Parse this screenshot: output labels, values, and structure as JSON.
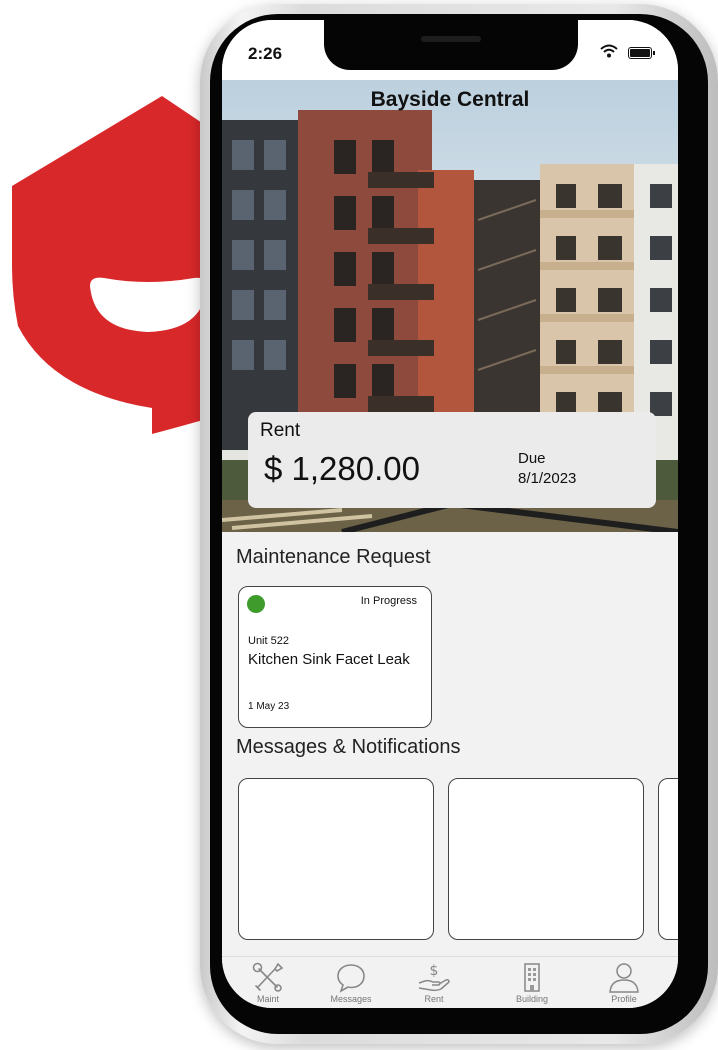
{
  "status_bar": {
    "time": "2:26"
  },
  "property": {
    "name": "Bayside Central"
  },
  "rent": {
    "label": "Rent",
    "amount": "$ 1,280.00",
    "due_label": "Due",
    "due_date": "8/1/2023"
  },
  "maintenance": {
    "title": "Maintenance Request",
    "request": {
      "status": "In Progress",
      "status_color": "#3f9b2c",
      "unit": "Unit 522",
      "issue": "Kitchen Sink Facet Leak",
      "date": "1 May 23"
    }
  },
  "messages": {
    "title": "Messages & Notifications"
  },
  "tabs": [
    {
      "label": "Maint",
      "icon": "wrench-screwdriver-icon"
    },
    {
      "label": "Messages",
      "icon": "chat-bubble-icon"
    },
    {
      "label": "Rent",
      "icon": "dollar-hand-icon"
    },
    {
      "label": "Building",
      "icon": "building-icon"
    },
    {
      "label": "Profile",
      "icon": "person-icon"
    }
  ],
  "colors": {
    "brand_red": "#d9282a",
    "status_green": "#3f9b2c"
  },
  "logo": {
    "icon": "brand-logo-icon"
  }
}
